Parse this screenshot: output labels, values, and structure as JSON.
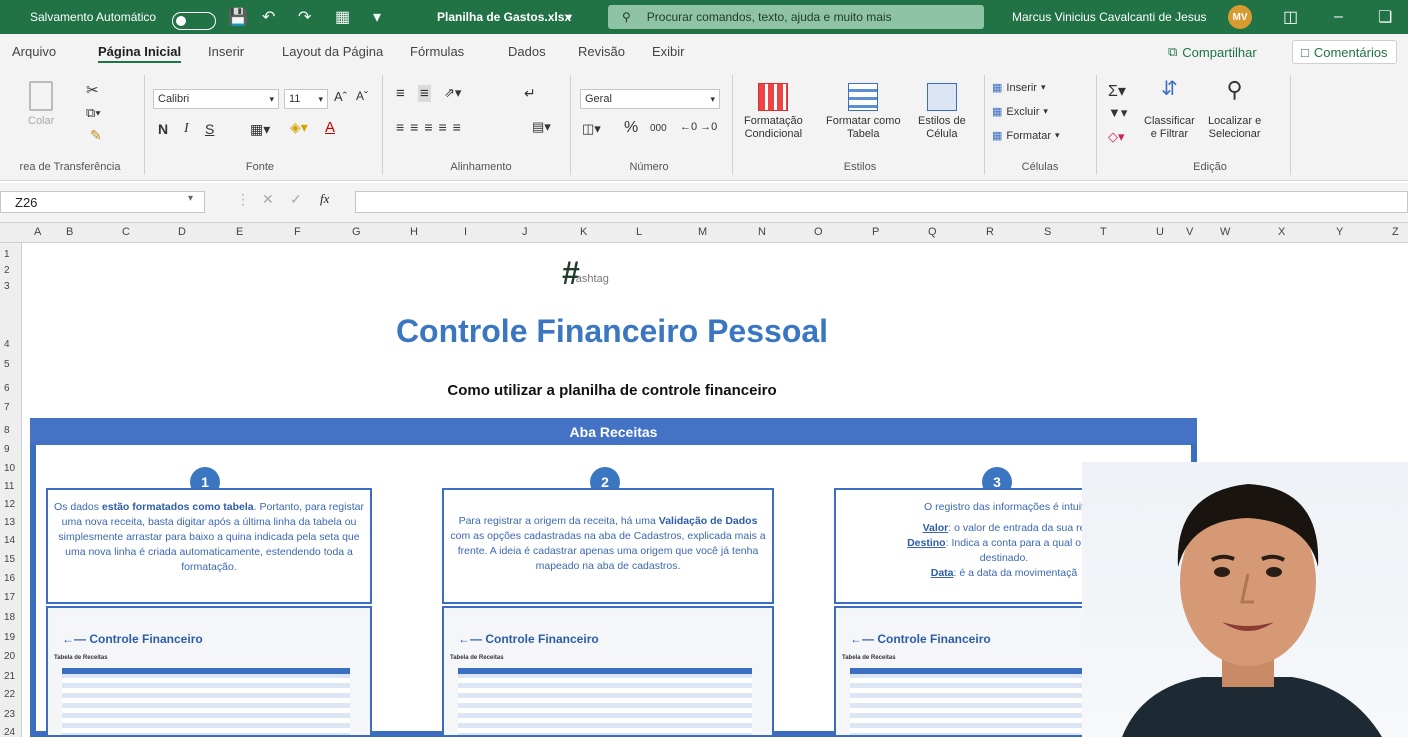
{
  "titlebar": {
    "autosave_label": "Salvamento Automático",
    "filename": "Planilha de Gastos.xlsx",
    "search_placeholder": "Procurar comandos, texto, ajuda e muito mais",
    "user_name": "Marcus Vinicius Cavalcanti de Jesus",
    "user_initials": "MV",
    "accent_color": "#217346"
  },
  "menu": {
    "tabs": [
      "Arquivo",
      "Página Inicial",
      "Inserir",
      "Layout da Página",
      "Fórmulas",
      "Dados",
      "Revisão",
      "Exibir"
    ],
    "active_tab": "Página Inicial",
    "share_label": "Compartilhar",
    "comments_label": "Comentários"
  },
  "ribbon": {
    "clipboard": {
      "paste_label": "Colar",
      "group_label": "rea de Transferência"
    },
    "font": {
      "font_name": "Calibri",
      "font_size": "11",
      "bold": "N",
      "italic": "I",
      "underline": "S",
      "group_label": "Fonte"
    },
    "alignment": {
      "group_label": "Alinhamento"
    },
    "number": {
      "format": "Geral",
      "percent": "%",
      "thousands": "000",
      "group_label": "Número"
    },
    "styles": {
      "conditional_line1": "Formatação",
      "conditional_line2": "Condicional",
      "table_line1": "Formatar como",
      "table_line2": "Tabela",
      "cell_line1": "Estilos de",
      "cell_line2": "Célula",
      "group_label": "Estilos"
    },
    "cells": {
      "insert": "Inserir",
      "delete": "Excluir",
      "format": "Formatar",
      "group_label": "Células"
    },
    "editing": {
      "sort_line1": "Classificar",
      "sort_line2": "e Filtrar",
      "find_line1": "Localizar e",
      "find_line2": "Selecionar",
      "group_label": "Edição"
    }
  },
  "formula_bar": {
    "cell_ref": "Z26",
    "fx": "fx",
    "content": ""
  },
  "columns": [
    "A",
    "B",
    "C",
    "D",
    "E",
    "F",
    "G",
    "H",
    "I",
    "J",
    "K",
    "L",
    "M",
    "N",
    "O",
    "P",
    "Q",
    "R",
    "S",
    "T",
    "U",
    "V",
    "W",
    "X",
    "Y",
    "Z"
  ],
  "rows": [
    "1",
    "2",
    "3",
    "4",
    "5",
    "6",
    "7",
    "8",
    "9",
    "10",
    "11",
    "12",
    "13",
    "14",
    "15",
    "16",
    "17",
    "18",
    "19",
    "20",
    "21",
    "22",
    "23",
    "24"
  ],
  "sheet": {
    "logo_text": "ashtag",
    "title": "Controle Financeiro Pessoal",
    "subtitle": "Como utilizar a planilha de controle financeiro",
    "banner": "Aba Receitas",
    "accent_color": "#3b77c0",
    "steps": [
      {
        "number": "1",
        "pre": "Os dados ",
        "bold": "estão formatados como tabela",
        "post": ". Portanto, para registar uma nova receita, basta digitar após a última linha da tabela ou simplesmente arrastar para baixo a quina indicada pela seta que uma nova linha é criada automaticamente, estendendo toda a formatação."
      },
      {
        "number": "2",
        "pre": "Para registrar a origem da receita, há uma ",
        "bold": "Validação de Dados",
        "post": " com as opções cadastradas na aba de Cadastros, explicada mais a frente. A ideia é cadastrar apenas uma origem que você já tenha mapeado na aba de cadastros."
      },
      {
        "number": "3",
        "intro": "O registro das informações é intuit",
        "valor_label": "Valor",
        "valor_text": ": o valor de entrada da sua re",
        "destino_label": "Destino",
        "destino_text": ": Indica a conta para a qual o seu",
        "destino_text2": "destinado.",
        "data_label": "Data",
        "data_text": ": é a data da movimentaçã"
      }
    ],
    "mini_title": "Controle Financeiro",
    "mini_subtitle": "Tabela de Receitas"
  }
}
